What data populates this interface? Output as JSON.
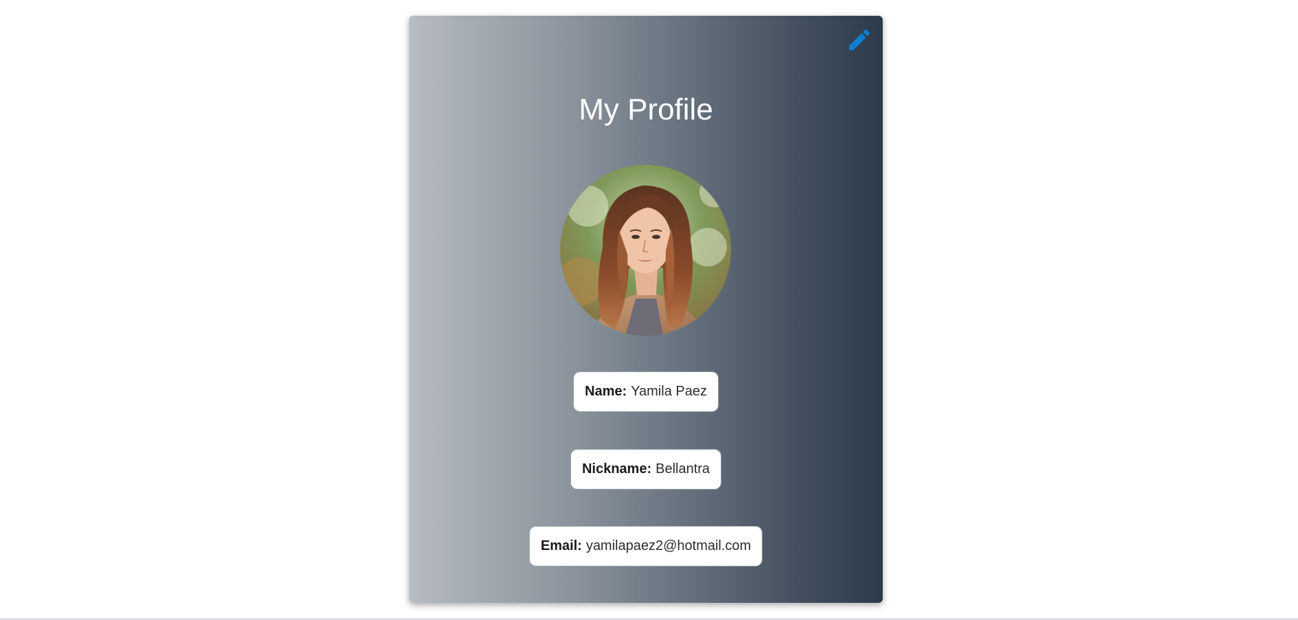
{
  "profile": {
    "title": "My Profile",
    "edit_icon": "pencil-icon",
    "avatar_alt": "",
    "fields": {
      "name": {
        "label": "Name:",
        "value": "Yamila Paez"
      },
      "nickname": {
        "label": "Nickname:",
        "value": "Bellantra"
      },
      "email": {
        "label": "Email:",
        "value": "yamilapaez2@hotmail.com"
      }
    }
  },
  "colors": {
    "accent": "#0a7fd0",
    "card_gradient_start": "#b7bdc2",
    "card_gradient_end": "#2c3a4c",
    "title_text": "#ffffff"
  }
}
